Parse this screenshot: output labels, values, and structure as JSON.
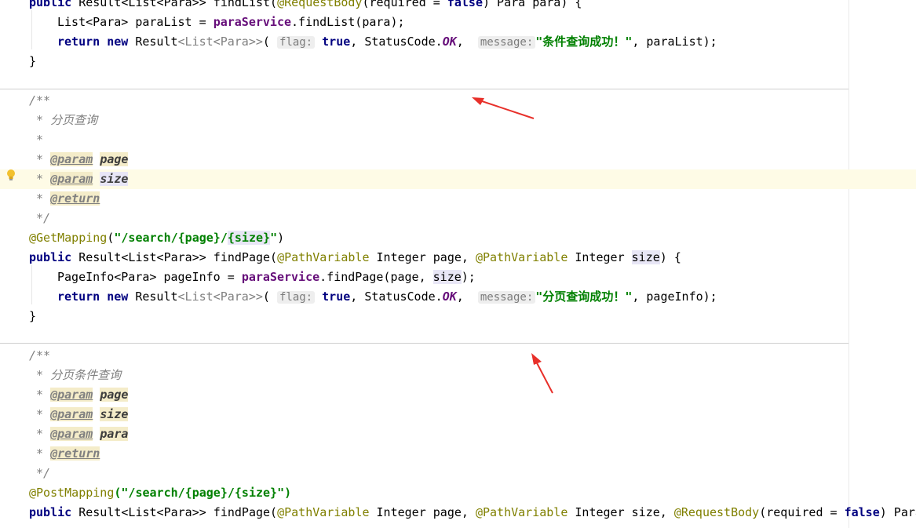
{
  "code": {
    "l0": {
      "a": "public ",
      "b": "Result<List<Para>> findList(",
      "c": "@RequestBody",
      "d": "(required = ",
      "e": "false",
      "f": ") Para para) {"
    },
    "l1": {
      "a": "List<Para> paraList = ",
      "b": "paraService",
      ".": ".findList(para);",
      "c": ".findList(para);"
    },
    "l2": {
      "ret": "return ",
      "new": "new ",
      "cls": "Result",
      "gen": "<List<Para>>",
      "open": "(",
      "hint1": "flag:",
      "tru": "true",
      ", ": ", ",
      "sc": "StatusCode.",
      "ok": "OK",
      ",": ",",
      "hint2": "message:",
      "msg": "\"条件查询成功！\"",
      "tail": ", paraList);"
    },
    "l3": "}",
    "c1": {
      "a": "/**",
      "b": " * 分页查询",
      "c": " *",
      "d1": " * ",
      "d2": "@param",
      "d3": " ",
      "d4": "page",
      "e4": "size",
      "f2": "@return",
      "g": " */"
    },
    "m1": {
      "ann": "@GetMapping",
      "p1": "(",
      "s1": "\"/search/{page}/",
      "s2": "{size}",
      "s3": "\"",
      ")": ")"
    },
    "m2": {
      "pub": "public ",
      "a": "Result<List<Para>> findPage(",
      "pv1": "@PathVariable",
      "b": " Integer page, ",
      "pv2": "@PathVariable",
      "c": " Integer ",
      "sz": "size",
      "d": ") {"
    },
    "m3": {
      "a": "PageInfo<Para> pageInfo = ",
      "svc": "paraService",
      "b": ".findPage(page, ",
      "sz": "size",
      "c": ");"
    },
    "m4": {
      "ret": "return ",
      "new": "new ",
      "cls": "Result",
      "gen": "<List<Para>>",
      "open": "(",
      "hint1": "flag:",
      "tru": "true",
      "sc": "StatusCode.",
      "ok": "OK",
      "hint2": "message:",
      "msg": "\"分页查询成功！\"",
      "tail": ", pageInfo);"
    },
    "m5": "}",
    "c2": {
      "a": "/**",
      "b": " * 分页条件查询",
      "p": " * ",
      "tag": "@param",
      "pg": "page",
      "sz": "size",
      "pa": "para",
      "ret": "@return",
      "end": " */"
    },
    "n1": {
      "ann": "@PostMapping",
      "s": "(\"/search/{page}/{size}\")"
    },
    "n2": {
      "pub": "public ",
      "a": "Result<List<Para>> findPage(",
      "pv1": "@PathVariable",
      "b": " Integer page, ",
      "pv2": "@PathVariable",
      "c": " Integer size, ",
      "rb": "@RequestBody",
      "d": "(required = ",
      "f": "false",
      "e": ") Para"
    }
  },
  "colors": {
    "keyword": "#000080",
    "annotation": "#808000",
    "string": "#008000",
    "comment": "#808080",
    "field": "#660e7a",
    "arrow": "#e8302a"
  },
  "icons": {
    "bulb": "lightbulb-icon",
    "arrow": "red-arrow-annotation"
  }
}
